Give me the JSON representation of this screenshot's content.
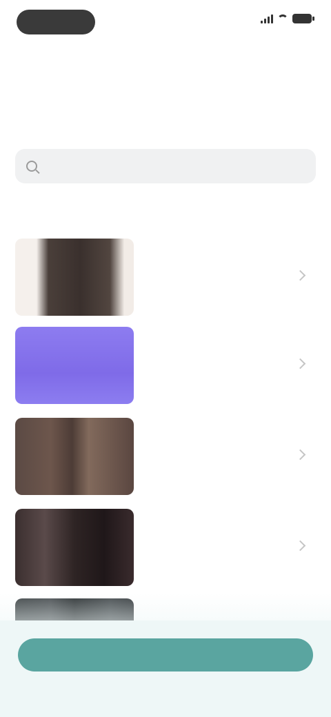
{
  "status_bar": {
    "time": "",
    "signal_icon": "signal-icon",
    "wifi_icon": "wifi-icon",
    "battery_icon": "battery-icon"
  },
  "header": {
    "title": "",
    "subtitle": ""
  },
  "search": {
    "placeholder": "",
    "value": ""
  },
  "section": {
    "label": ""
  },
  "items": [
    {
      "title": "",
      "meta": "",
      "chevron_icon": "chevron-right-icon"
    },
    {
      "title": "",
      "meta": "",
      "chevron_icon": "chevron-right-icon"
    },
    {
      "title": "",
      "meta": "",
      "chevron_icon": "chevron-right-icon"
    },
    {
      "title": "",
      "meta": "",
      "chevron_icon": "chevron-right-icon"
    },
    {
      "title": "",
      "meta": ""
    }
  ],
  "cta": {
    "label": ""
  },
  "colors": {
    "accent": "#5aa5a0",
    "highlight": "#8d7cf0",
    "background": "#ffffff",
    "footer_tint": "#eef7f7"
  }
}
